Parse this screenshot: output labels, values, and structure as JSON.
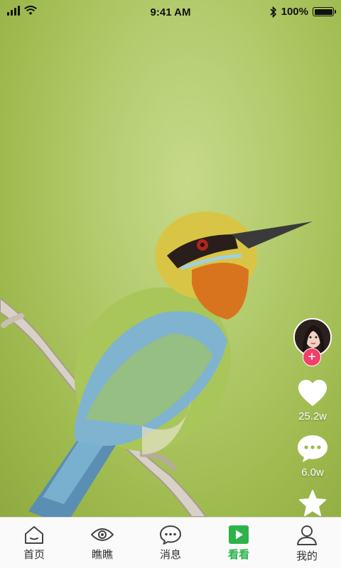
{
  "status_bar": {
    "time": "9:41 AM",
    "battery": "100%",
    "battery_level": 1.0
  },
  "video": {
    "subject_icon": "bird-on-branch"
  },
  "actions": {
    "follow_label": "+",
    "like_count": "25.2w",
    "comment_count": "6.0w"
  },
  "tabs": [
    {
      "label": "首页",
      "icon": "home-icon"
    },
    {
      "label": "瞧瞧",
      "icon": "eye-icon"
    },
    {
      "label": "消息",
      "icon": "message-icon"
    },
    {
      "label": "看看",
      "icon": "play-icon",
      "active": true
    },
    {
      "label": "我的",
      "icon": "user-icon"
    }
  ],
  "colors": {
    "accent": "#2cb34a",
    "follow": "#f0406a"
  }
}
